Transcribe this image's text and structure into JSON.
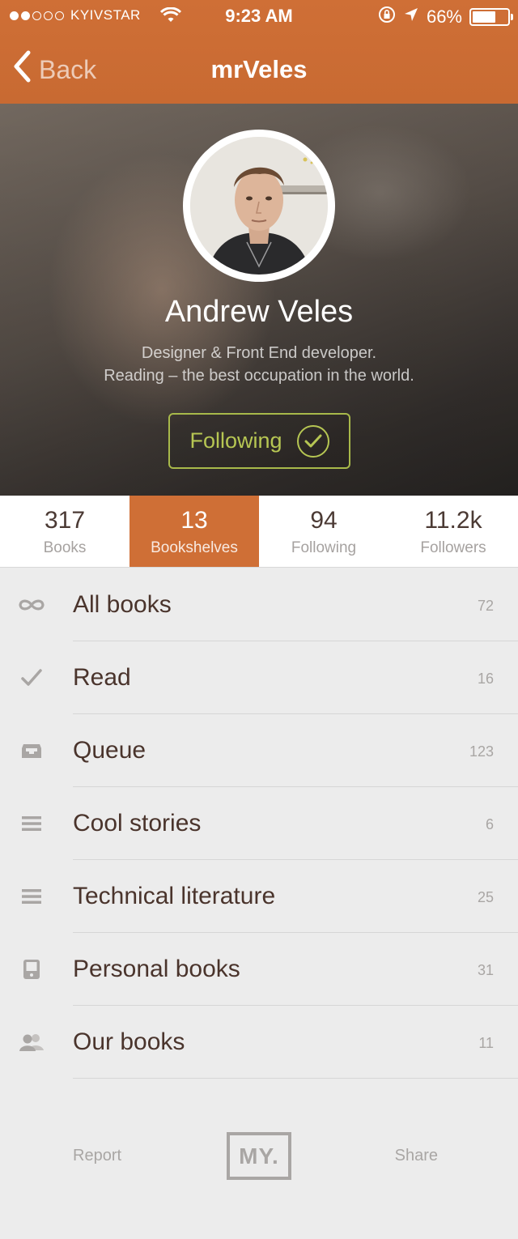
{
  "status_bar": {
    "carrier": "KYIVSTAR",
    "time": "9:23 AM",
    "battery": "66%",
    "battery_level": 0.66,
    "signal_bars_filled": 2,
    "signal_bars_total": 5
  },
  "nav": {
    "back_label": "Back",
    "title": "mrVeles"
  },
  "profile": {
    "name": "Andrew Veles",
    "bio_line1": "Designer & Front End developer.",
    "bio_line2": "Reading – the best occupation in the world.",
    "follow_label": "Following",
    "follow_state": "following"
  },
  "stats": [
    {
      "value": "317",
      "label": "Books",
      "active": false
    },
    {
      "value": "13",
      "label": "Bookshelves",
      "active": true
    },
    {
      "value": "94",
      "label": "Following",
      "active": false
    },
    {
      "value": "11.2k",
      "label": "Followers",
      "active": false
    }
  ],
  "shelves": [
    {
      "label": "All books",
      "count": "72",
      "icon": "infinity-icon"
    },
    {
      "label": "Read",
      "count": "16",
      "icon": "checkmark-icon"
    },
    {
      "label": "Queue",
      "count": "123",
      "icon": "inbox-tray-icon"
    },
    {
      "label": "Cool stories",
      "count": "6",
      "icon": "list-lines-icon"
    },
    {
      "label": "Technical literature",
      "count": "25",
      "icon": "list-lines-icon"
    },
    {
      "label": "Personal books",
      "count": "31",
      "icon": "tablet-device-icon"
    },
    {
      "label": "Our books",
      "count": "11",
      "icon": "people-icon"
    }
  ],
  "footer": {
    "report_label": "Report",
    "logo_text": "MY.",
    "share_label": "Share"
  },
  "colors": {
    "accent": "#cf6f36",
    "follow_green": "#b6c653",
    "text_dark": "#4a342c",
    "text_muted": "#a9a6a4",
    "background": "#ececec"
  }
}
